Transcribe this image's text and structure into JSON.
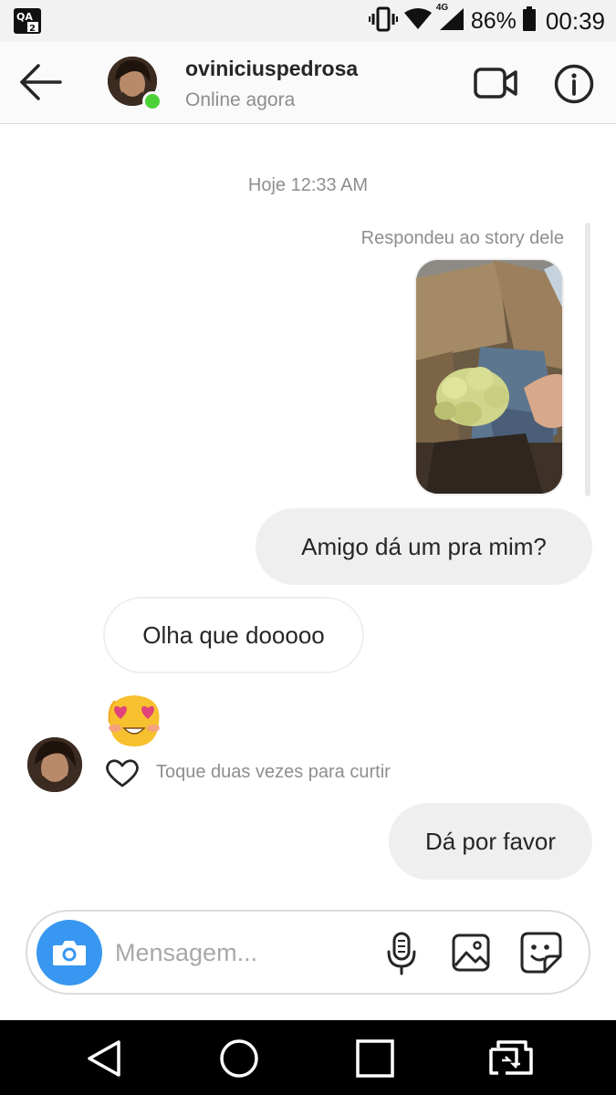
{
  "status_bar": {
    "battery": "86%",
    "time": "00:39",
    "network": "4G",
    "icons": [
      "screen-mirror-icon",
      "vibrate-icon",
      "wifi-icon",
      "signal-icon",
      "battery-icon"
    ]
  },
  "header": {
    "username": "oviniciuspedrosa",
    "presence": "Online agora",
    "online_color": "#4cd137",
    "icons": [
      "back-arrow-icon",
      "video-call-icon",
      "info-icon"
    ]
  },
  "thread": {
    "timestamp": "Hoje 12:33 AM",
    "story_reply_label": "Respondeu ao story dele",
    "messages": [
      {
        "side": "outgoing",
        "text": "Amigo dá um pra mim?"
      },
      {
        "side": "incoming",
        "text": "Olha que dooooo"
      },
      {
        "side": "incoming",
        "emoji": "😍",
        "icon": "heart-eyes-emoji-icon"
      },
      {
        "side": "outgoing",
        "text": "Dá por favor"
      }
    ],
    "like_hint": "Toque duas vezes para curtir"
  },
  "composer": {
    "placeholder": "Mensagem...",
    "accent_color": "#3897f0",
    "icons": [
      "camera-icon",
      "microphone-icon",
      "gallery-icon",
      "sticker-icon"
    ]
  },
  "nav_bar": {
    "icons": [
      "nav-back-icon",
      "nav-home-icon",
      "nav-recents-icon",
      "nav-switch-icon"
    ]
  }
}
